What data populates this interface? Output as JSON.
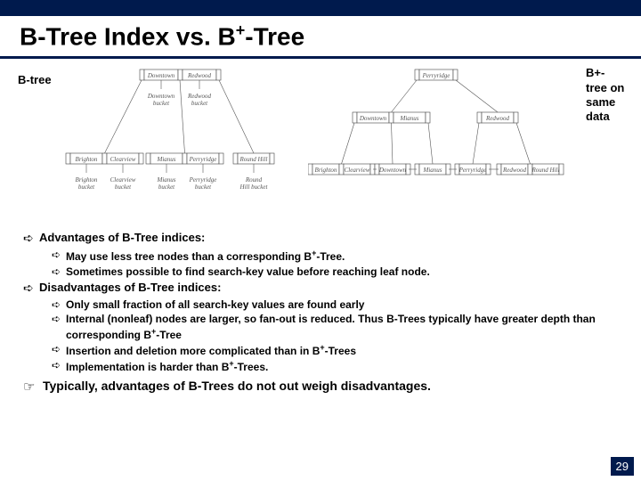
{
  "title_html": "B-Tree Index vs. B<sup>+</sup>-Tree",
  "labels": {
    "left": "B-tree",
    "right": "B+-tree on same data"
  },
  "btree": {
    "root": [
      "Downtown",
      "Redwood"
    ],
    "mid": [
      [
        "Downtown bucket"
      ],
      [
        "Redwood bucket"
      ]
    ],
    "leaves": [
      [
        "Brighton",
        "Clearview"
      ],
      [
        "Mianus",
        "Perryridge"
      ],
      [
        "Round Hill"
      ]
    ],
    "buckets": [
      "Brighton bucket",
      "Clearview bucket",
      "Mianus bucket",
      "Perryridge bucket",
      "Round Hill bucket"
    ]
  },
  "bplus": {
    "root": [
      "Perryridge"
    ],
    "mid": [
      [
        "Downtown",
        "Mianus"
      ],
      [
        "Redwood"
      ]
    ],
    "leaves": [
      [
        "Brighton",
        "Clearview"
      ],
      [
        "Downtown"
      ],
      [
        "Mianus"
      ],
      [
        "Perryridge"
      ],
      [
        "Redwood",
        "Round Hill"
      ]
    ]
  },
  "bullets": {
    "adv_head": "Advantages of B-Tree indices:",
    "adv_items": [
      "May use less tree nodes than a corresponding B<sup>+</sup>-Tree.",
      "Sometimes possible to find search-key value before reaching leaf node."
    ],
    "dis_head": "Disadvantages of B-Tree indices:",
    "dis_items": [
      "Only small fraction of all search-key values are found early",
      "Internal (nonleaf) nodes are larger, so fan-out is reduced.  Thus B-Trees typically have greater depth than corresponding B<sup>+</sup>-Tree",
      "Insertion and deletion more complicated than in B<sup>+</sup>-Trees",
      "Implementation is harder than B<sup>+</sup>-Trees."
    ],
    "summary": "Typically, advantages of B-Trees do not out weigh disadvantages."
  },
  "slide_number": "29"
}
